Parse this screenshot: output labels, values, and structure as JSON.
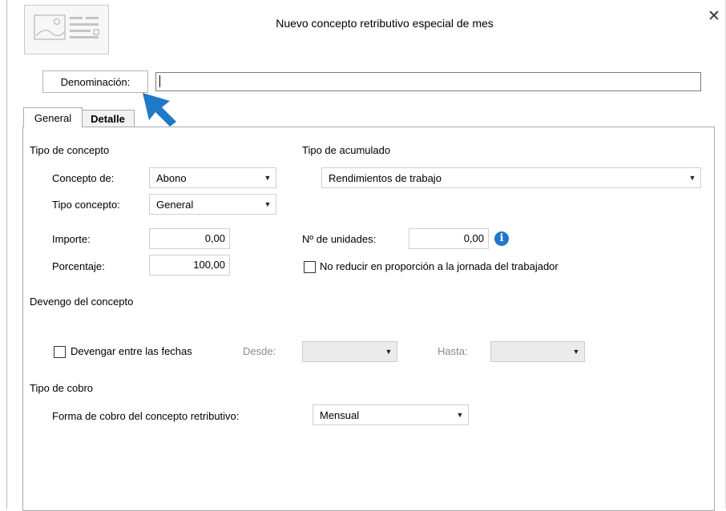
{
  "window": {
    "title": "Nuevo concepto retributivo especial de mes",
    "close_icon": "✕"
  },
  "header": {
    "denominacion_label": "Denominación:",
    "denominacion_value": ""
  },
  "tabs": [
    {
      "label": "General",
      "active": true
    },
    {
      "label": "Detalle",
      "active": false
    }
  ],
  "tipo_concepto": {
    "heading": "Tipo de concepto",
    "concepto_de_label": "Concepto de:",
    "concepto_de_value": "Abono",
    "tipo_concepto_label": "Tipo concepto:",
    "tipo_concepto_value": "General",
    "importe_label": "Importe:",
    "importe_value": "0,00",
    "porcentaje_label": "Porcentaje:",
    "porcentaje_value": "100,00"
  },
  "tipo_acumulado": {
    "heading": "Tipo de acumulado",
    "value": "Rendimientos de trabajo",
    "unidades_label": "Nº de unidades:",
    "unidades_value": "0,00",
    "info_icon": "i",
    "no_reducir_label": "No reducir en proporción a la jornada del trabajador",
    "no_reducir_checked": false
  },
  "devengo": {
    "heading": "Devengo del concepto",
    "devengar_label": "Devengar entre las fechas",
    "devengar_checked": false,
    "desde_label": "Desde:",
    "desde_value": "",
    "hasta_label": "Hasta:",
    "hasta_value": ""
  },
  "tipo_cobro": {
    "heading": "Tipo de cobro",
    "forma_label": "Forma de cobro del concepto retributivo:",
    "forma_value": "Mensual"
  },
  "colors": {
    "cursor_arrow": "#1f78c8",
    "info_icon_bg": "#1f78c8"
  },
  "dropdown_arrow": "▼"
}
